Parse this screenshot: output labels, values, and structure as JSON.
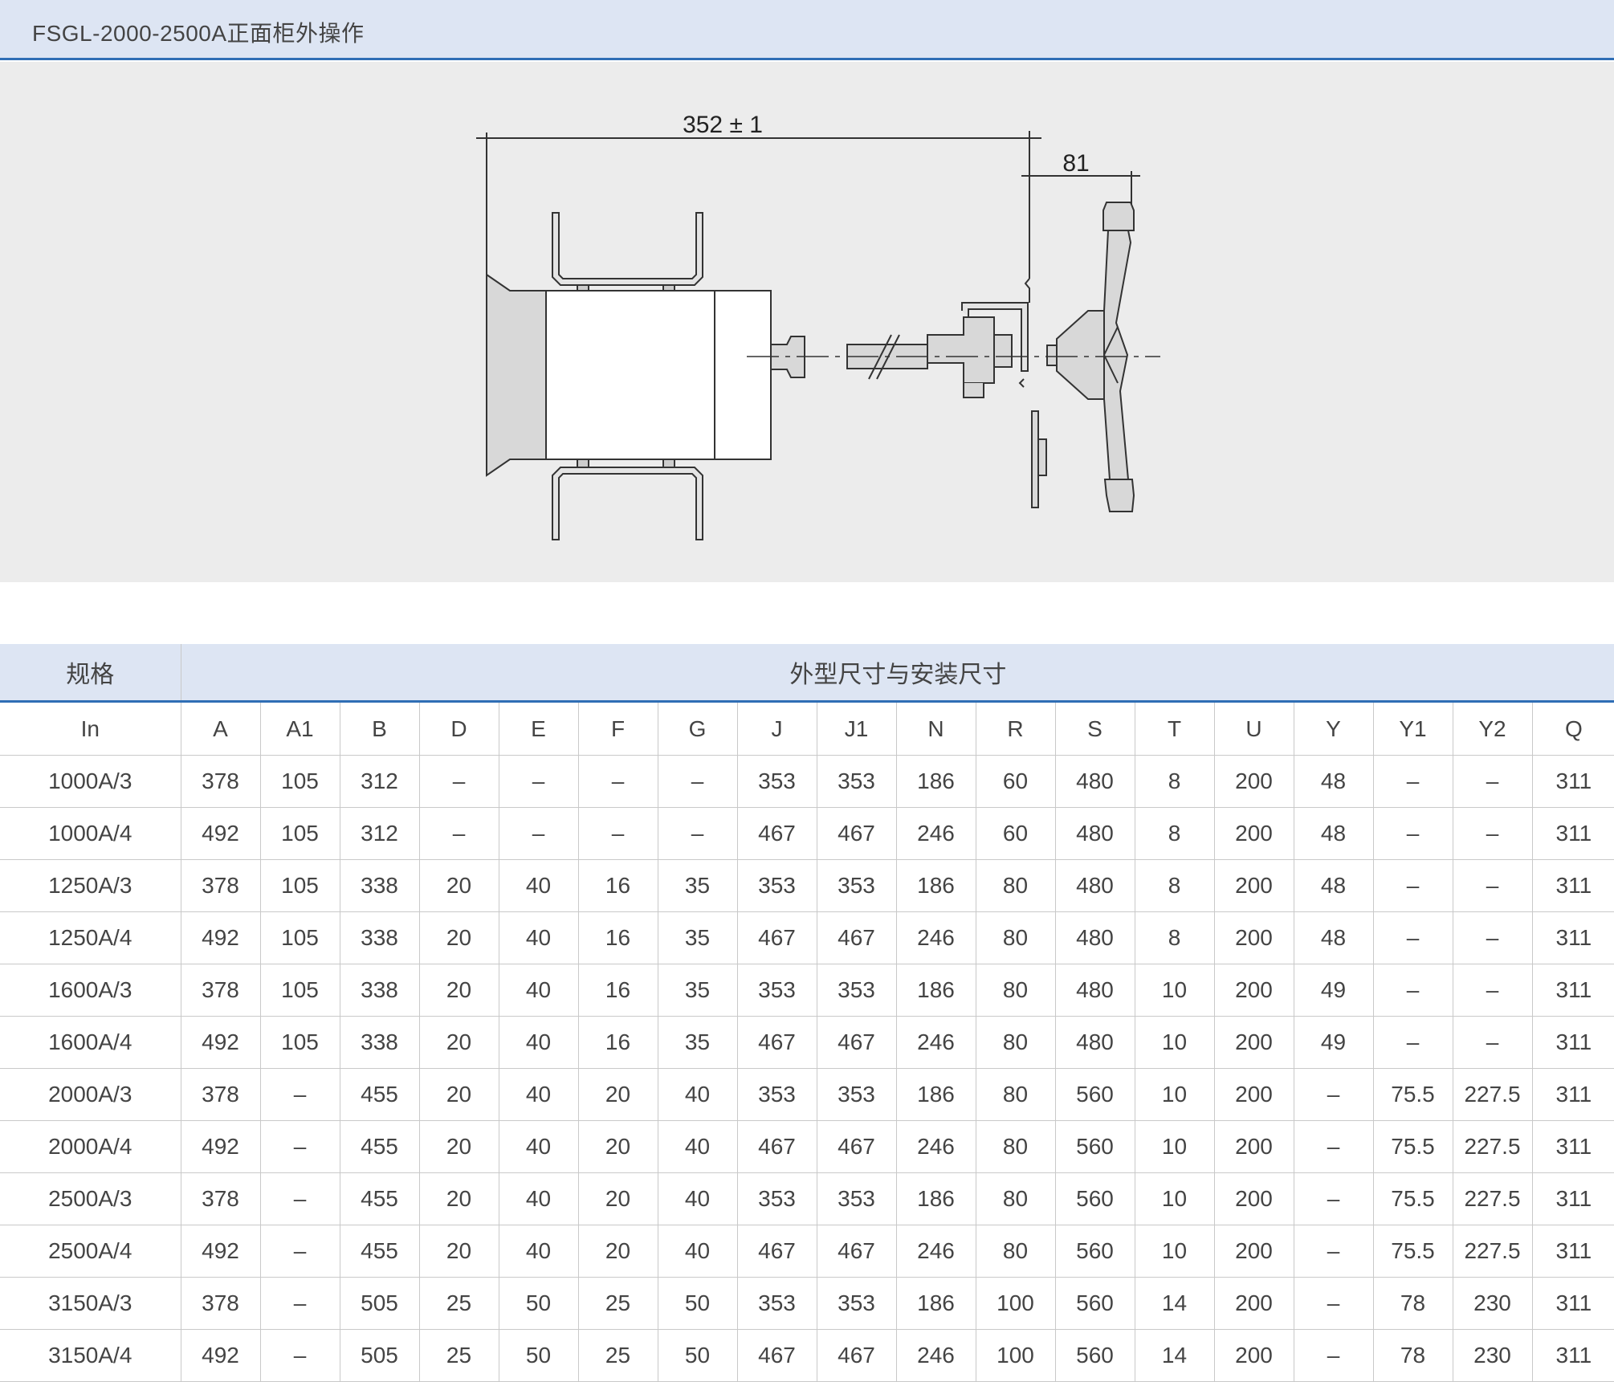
{
  "header": {
    "title": "FSGL-2000-2500A正面柜外操作"
  },
  "drawing": {
    "dim_main": "352 ± 1",
    "dim_handle": "81"
  },
  "table": {
    "spec_header": "规格",
    "group_header": "外型尺寸与安装尺寸",
    "columns": [
      "In",
      "A",
      "A1",
      "B",
      "D",
      "E",
      "F",
      "G",
      "J",
      "J1",
      "N",
      "R",
      "S",
      "T",
      "U",
      "Y",
      "Y1",
      "Y2",
      "Q"
    ],
    "rows": [
      [
        "1000A/3",
        "378",
        "105",
        "312",
        "–",
        "–",
        "–",
        "–",
        "353",
        "353",
        "186",
        "60",
        "480",
        "8",
        "200",
        "48",
        "–",
        "–",
        "311"
      ],
      [
        "1000A/4",
        "492",
        "105",
        "312",
        "–",
        "–",
        "–",
        "–",
        "467",
        "467",
        "246",
        "60",
        "480",
        "8",
        "200",
        "48",
        "–",
        "–",
        "311"
      ],
      [
        "1250A/3",
        "378",
        "105",
        "338",
        "20",
        "40",
        "16",
        "35",
        "353",
        "353",
        "186",
        "80",
        "480",
        "8",
        "200",
        "48",
        "–",
        "–",
        "311"
      ],
      [
        "1250A/4",
        "492",
        "105",
        "338",
        "20",
        "40",
        "16",
        "35",
        "467",
        "467",
        "246",
        "80",
        "480",
        "8",
        "200",
        "48",
        "–",
        "–",
        "311"
      ],
      [
        "1600A/3",
        "378",
        "105",
        "338",
        "20",
        "40",
        "16",
        "35",
        "353",
        "353",
        "186",
        "80",
        "480",
        "10",
        "200",
        "49",
        "–",
        "–",
        "311"
      ],
      [
        "1600A/4",
        "492",
        "105",
        "338",
        "20",
        "40",
        "16",
        "35",
        "467",
        "467",
        "246",
        "80",
        "480",
        "10",
        "200",
        "49",
        "–",
        "–",
        "311"
      ],
      [
        "2000A/3",
        "378",
        "–",
        "455",
        "20",
        "40",
        "20",
        "40",
        "353",
        "353",
        "186",
        "80",
        "560",
        "10",
        "200",
        "–",
        "75.5",
        "227.5",
        "311"
      ],
      [
        "2000A/4",
        "492",
        "–",
        "455",
        "20",
        "40",
        "20",
        "40",
        "467",
        "467",
        "246",
        "80",
        "560",
        "10",
        "200",
        "–",
        "75.5",
        "227.5",
        "311"
      ],
      [
        "2500A/3",
        "378",
        "–",
        "455",
        "20",
        "40",
        "20",
        "40",
        "353",
        "353",
        "186",
        "80",
        "560",
        "10",
        "200",
        "–",
        "75.5",
        "227.5",
        "311"
      ],
      [
        "2500A/4",
        "492",
        "–",
        "455",
        "20",
        "40",
        "20",
        "40",
        "467",
        "467",
        "246",
        "80",
        "560",
        "10",
        "200",
        "–",
        "75.5",
        "227.5",
        "311"
      ],
      [
        "3150A/3",
        "378",
        "–",
        "505",
        "25",
        "50",
        "25",
        "50",
        "353",
        "353",
        "186",
        "100",
        "560",
        "14",
        "200",
        "–",
        "78",
        "230",
        "311"
      ],
      [
        "3150A/4",
        "492",
        "–",
        "505",
        "25",
        "50",
        "25",
        "50",
        "467",
        "467",
        "246",
        "100",
        "560",
        "14",
        "200",
        "–",
        "78",
        "230",
        "311"
      ]
    ]
  }
}
